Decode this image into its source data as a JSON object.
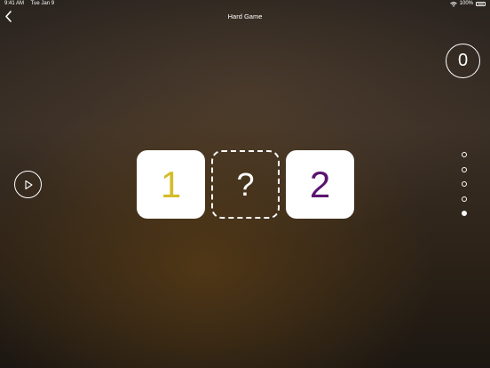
{
  "status_bar": {
    "time": "9:41 AM",
    "date": "Tue Jan 9",
    "battery": "100%"
  },
  "header": {
    "title": "Hard Game",
    "back_icon": "chevron-left-icon"
  },
  "score": {
    "value": "0"
  },
  "play_icon": "play-icon",
  "cards": [
    {
      "label": "1",
      "color": "#d4bd2a"
    },
    {
      "label": "?",
      "color": "#ffffff"
    },
    {
      "label": "2",
      "color": "#5a1470"
    }
  ],
  "pager": {
    "total": 5,
    "active_index": 4
  }
}
